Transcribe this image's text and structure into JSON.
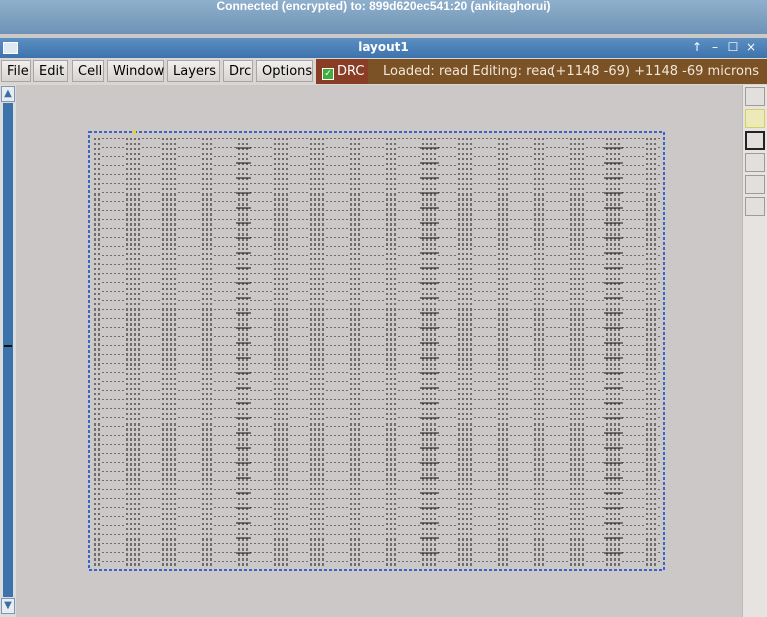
{
  "vnc_banner": "Connected (encrypted) to: 899d620ec541:20 (ankitaghorui)",
  "window": {
    "title": "layout1",
    "controls": {
      "up": "↑",
      "minimize": "–",
      "maximize": "☐",
      "close": "×"
    }
  },
  "menu": {
    "file": "File",
    "edit": "Edit",
    "cell": "Cell",
    "window": "Window",
    "layers": "Layers",
    "drc": "Drc",
    "options": "Options"
  },
  "drc_toggle": {
    "label": "DRC",
    "checked": true,
    "color": "#8a3d25"
  },
  "status": {
    "loaded": "Loaded: read Editing: reac",
    "coords": "(+1148 -69) +1148 -69 microns",
    "color": "#7a5226"
  },
  "colors": {
    "chip_border": "#3a64c8",
    "chip_fill": "#cdc8c8",
    "scrollbar": "#3d73ad"
  },
  "icons": [
    "window-icon",
    "scroll-up-icon",
    "scroll-down-icon",
    "check-icon"
  ]
}
